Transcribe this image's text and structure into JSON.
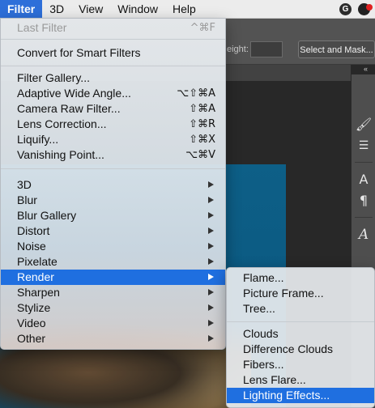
{
  "menubar": {
    "items": [
      "Filter",
      "3D",
      "View",
      "Window",
      "Help"
    ],
    "active": "Filter",
    "status_g": "G"
  },
  "photoshop": {
    "height_label": "eight:",
    "select_mask_label": "Select and Mask...",
    "collapse_glyph": "«",
    "panel_icons": [
      "brush-icon",
      "sliders-icon",
      "type-icon",
      "paragraph-icon",
      "glyph-icon"
    ]
  },
  "filter_menu": {
    "last_filter": {
      "label": "Last Filter",
      "shortcut": "^⌘F"
    },
    "convert_smart": {
      "label": "Convert for Smart Filters"
    },
    "gallery": [
      {
        "label": "Filter Gallery...",
        "shortcut": ""
      },
      {
        "label": "Adaptive Wide Angle...",
        "shortcut": "⌥⇧⌘A"
      },
      {
        "label": "Camera Raw Filter...",
        "shortcut": "⇧⌘A"
      },
      {
        "label": "Lens Correction...",
        "shortcut": "⇧⌘R"
      },
      {
        "label": "Liquify...",
        "shortcut": "⇧⌘X"
      },
      {
        "label": "Vanishing Point...",
        "shortcut": "⌥⌘V"
      }
    ],
    "submenus": [
      {
        "label": "3D"
      },
      {
        "label": "Blur"
      },
      {
        "label": "Blur Gallery"
      },
      {
        "label": "Distort"
      },
      {
        "label": "Noise"
      },
      {
        "label": "Pixelate"
      },
      {
        "label": "Render",
        "highlighted": true
      },
      {
        "label": "Sharpen"
      },
      {
        "label": "Stylize"
      },
      {
        "label": "Video"
      },
      {
        "label": "Other"
      }
    ]
  },
  "render_menu": {
    "group1": [
      {
        "label": "Flame..."
      },
      {
        "label": "Picture Frame..."
      },
      {
        "label": "Tree..."
      }
    ],
    "group2": [
      {
        "label": "Clouds"
      },
      {
        "label": "Difference Clouds"
      },
      {
        "label": "Fibers..."
      },
      {
        "label": "Lens Flare..."
      },
      {
        "label": "Lighting Effects...",
        "highlighted": true
      }
    ]
  },
  "colors": {
    "highlight": "#1f6fe0",
    "menubar_active": "#2e6fd9",
    "canvas_blue": "#0c5a82"
  }
}
